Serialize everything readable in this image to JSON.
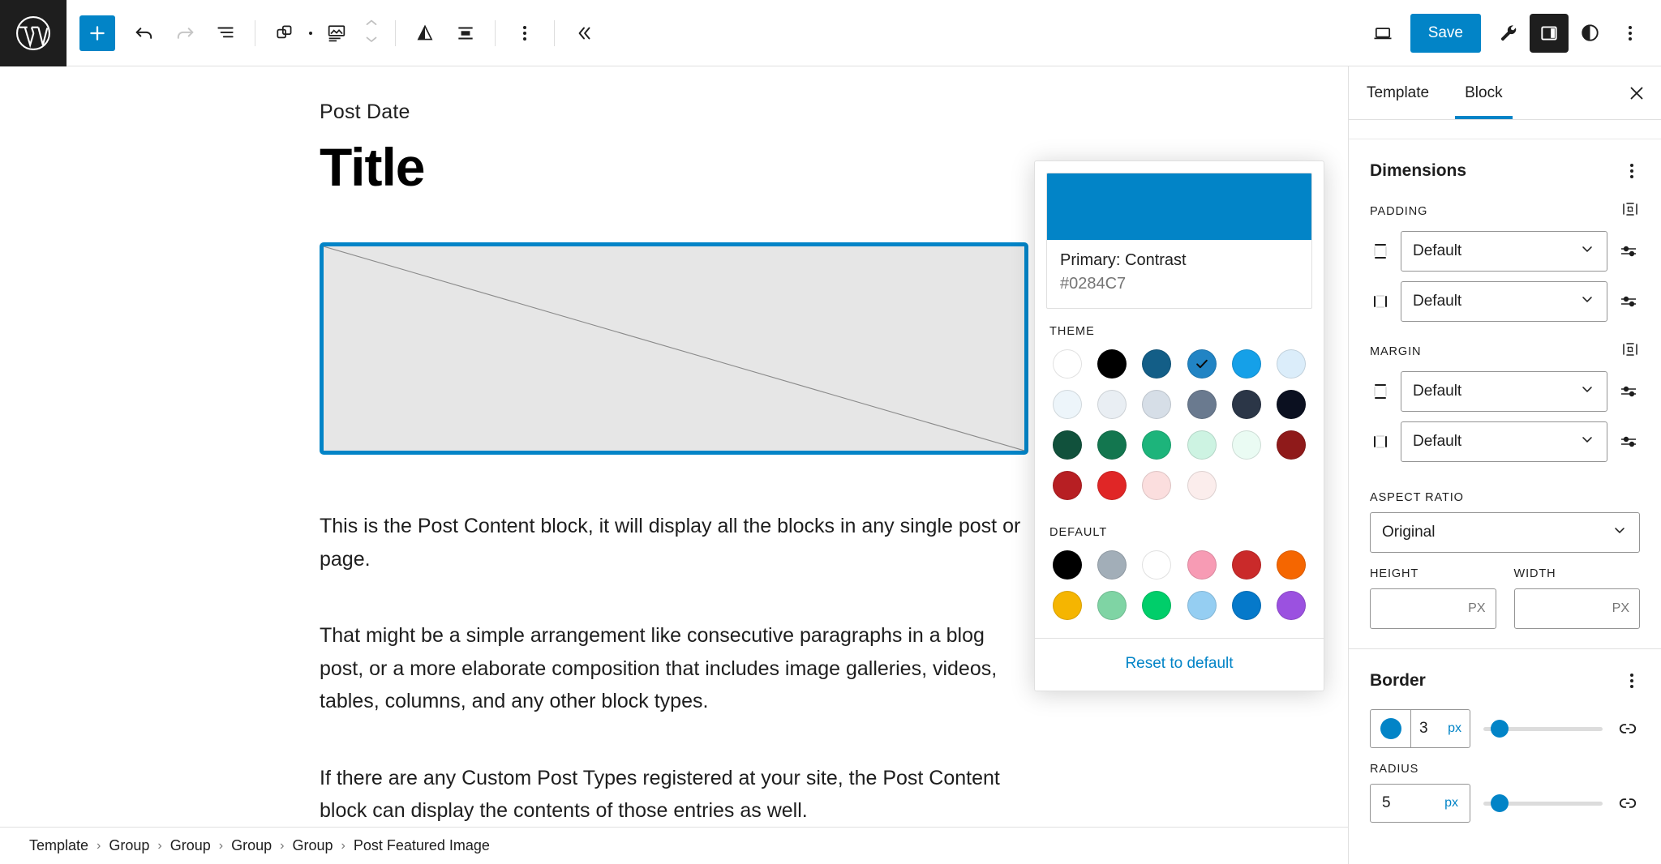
{
  "topbar": {
    "logo_icon": "wordpress-logo-icon",
    "left_tools": [
      {
        "name": "add-block-button",
        "icon": "plus-icon",
        "label": "Add block"
      },
      {
        "name": "undo-button",
        "icon": "undo-arrow-icon",
        "label": "Undo"
      },
      {
        "name": "redo-button",
        "icon": "redo-arrow-icon",
        "label": "Redo"
      },
      {
        "name": "list-view-button",
        "icon": "list-view-icon",
        "label": "Document Overview"
      },
      {
        "name": "block-type-button",
        "icon": "group-blocks-icon",
        "label": "Post Featured Image"
      },
      {
        "name": "image-block-button",
        "icon": "image-block-icon",
        "label": "Image"
      },
      {
        "name": "move-updown-button",
        "icon": "chevron-up-down-icon",
        "label": "Move"
      },
      {
        "name": "duotone-button",
        "icon": "duotone-triangle-icon",
        "label": "Apply duotone filter"
      },
      {
        "name": "align-button",
        "icon": "align-center-icon",
        "label": "Align"
      },
      {
        "name": "block-options-button",
        "icon": "kebab-vertical-icon",
        "label": "Options"
      },
      {
        "name": "collapse-toolbar-button",
        "icon": "double-chevron-left-icon",
        "label": "Collapse"
      }
    ],
    "right_tools": [
      {
        "name": "preview-button",
        "icon": "laptop-preview-icon",
        "label": "View"
      },
      {
        "name": "settings-tools-button",
        "icon": "wrench-icon",
        "label": "Tools"
      },
      {
        "name": "sidebar-toggle-button",
        "icon": "sidebar-panel-icon",
        "label": "Settings"
      },
      {
        "name": "styles-button",
        "icon": "contrast-circle-icon",
        "label": "Styles"
      },
      {
        "name": "more-options-button",
        "icon": "kebab-vertical-icon",
        "label": "Options"
      }
    ],
    "save_label": "Save"
  },
  "editor": {
    "post_date": "Post Date",
    "title": "Title",
    "featured_image_alt": "Post Featured Image placeholder",
    "paragraphs": [
      "This is the Post Content block, it will display all the blocks in any single post or page.",
      "That might be a simple arrangement like consecutive paragraphs in a blog post, or a more elaborate composition that includes image galleries, videos, tables, columns, and any other block types.",
      "If there are any Custom Post Types registered at your site, the Post Content block can display the contents of those entries as well."
    ]
  },
  "breadcrumb": {
    "separator": "›",
    "items": [
      "Template",
      "Group",
      "Group",
      "Group",
      "Group",
      "Post Featured Image"
    ]
  },
  "sidebar": {
    "tabs": [
      {
        "label": "Template",
        "active": false
      },
      {
        "label": "Block",
        "active": true
      }
    ],
    "close_icon": "close-x-icon",
    "dimensions": {
      "title": "Dimensions",
      "options_icon": "kebab-vertical-icon",
      "padding": {
        "label": "PADDING",
        "link_icon": "link-sides-icon",
        "top_bottom": {
          "icon": "padding-vertical-icon",
          "value": "Default",
          "slider_icon": "sliders-icon"
        },
        "left_right": {
          "icon": "padding-horizontal-icon",
          "value": "Default",
          "slider_icon": "sliders-icon"
        }
      },
      "margin": {
        "label": "MARGIN",
        "link_icon": "link-sides-icon",
        "top_bottom": {
          "icon": "margin-vertical-icon",
          "value": "Default",
          "slider_icon": "sliders-icon"
        },
        "left_right": {
          "icon": "margin-horizontal-icon",
          "value": "Default",
          "slider_icon": "sliders-icon"
        }
      },
      "aspect_ratio": {
        "label": "ASPECT RATIO",
        "value": "Original"
      },
      "height": {
        "label": "HEIGHT",
        "value": "",
        "unit": "PX"
      },
      "width": {
        "label": "WIDTH",
        "value": "",
        "unit": "PX"
      }
    },
    "border": {
      "title": "Border",
      "options_icon": "kebab-vertical-icon",
      "color": "#0284C7",
      "width_value": "3",
      "width_unit": "px",
      "width_slider_percent": 6,
      "link_icon": "link-unlinked-icon",
      "radius": {
        "label": "RADIUS",
        "value": "5",
        "unit": "px",
        "slider_percent": 6,
        "link_icon": "link-unlinked-icon"
      }
    }
  },
  "color_popover": {
    "preview": {
      "color": "#0284C7",
      "name": "Primary: Contrast",
      "hex": "#0284C7"
    },
    "theme": {
      "title": "THEME",
      "swatches": [
        {
          "name": "base",
          "hex": "#FFFFFF",
          "selected": false
        },
        {
          "name": "contrast",
          "hex": "#000000",
          "selected": false
        },
        {
          "name": "primary",
          "hex": "#135E87",
          "selected": false
        },
        {
          "name": "primary-contrast",
          "hex": "#2184C4",
          "selected": true
        },
        {
          "name": "primary-accent",
          "hex": "#15A0E8",
          "selected": false
        },
        {
          "name": "primary-light",
          "hex": "#DBEDFA",
          "selected": false
        },
        {
          "name": "base-2",
          "hex": "#EDF5FA",
          "selected": false
        },
        {
          "name": "base-3",
          "hex": "#E9EEF3",
          "selected": false
        },
        {
          "name": "base-4",
          "hex": "#D6DEE7",
          "selected": false
        },
        {
          "name": "neutral",
          "hex": "#6A7A8F",
          "selected": false
        },
        {
          "name": "neutral-dark",
          "hex": "#2B3647",
          "selected": false
        },
        {
          "name": "neutral-darkest",
          "hex": "#0B1020",
          "selected": false
        },
        {
          "name": "secondary-dark",
          "hex": "#11513C",
          "selected": false
        },
        {
          "name": "secondary",
          "hex": "#13764F",
          "selected": false
        },
        {
          "name": "secondary-accent",
          "hex": "#1DB47B",
          "selected": false
        },
        {
          "name": "secondary-light",
          "hex": "#CDF3E2",
          "selected": false
        },
        {
          "name": "secondary-lightest",
          "hex": "#EAFBF3",
          "selected": false
        },
        {
          "name": "tertiary-dark",
          "hex": "#8F1A1A",
          "selected": false
        },
        {
          "name": "tertiary",
          "hex": "#B71F23",
          "selected": false
        },
        {
          "name": "tertiary-accent",
          "hex": "#E02626",
          "selected": false
        },
        {
          "name": "tertiary-light",
          "hex": "#FBDEDE",
          "selected": false
        },
        {
          "name": "tertiary-lightest",
          "hex": "#FBEDEC",
          "selected": false
        }
      ]
    },
    "default": {
      "title": "DEFAULT",
      "swatches": [
        {
          "name": "black",
          "hex": "#000000"
        },
        {
          "name": "cyan-bluish-gray",
          "hex": "#A2AEB8"
        },
        {
          "name": "white",
          "hex": "#FFFFFF"
        },
        {
          "name": "pale-pink",
          "hex": "#F79BB4"
        },
        {
          "name": "vivid-red",
          "hex": "#CA2A2A"
        },
        {
          "name": "luminous-vivid-orange",
          "hex": "#F56600"
        },
        {
          "name": "luminous-vivid-amber",
          "hex": "#F5B501"
        },
        {
          "name": "light-green-cyan",
          "hex": "#7FD4A4"
        },
        {
          "name": "vivid-green-cyan",
          "hex": "#00CE6A"
        },
        {
          "name": "pale-cyan-blue",
          "hex": "#95CEF2"
        },
        {
          "name": "vivid-cyan-blue",
          "hex": "#0579CA"
        },
        {
          "name": "vivid-purple",
          "hex": "#9B51E0"
        }
      ]
    },
    "reset_label": "Reset to default"
  }
}
